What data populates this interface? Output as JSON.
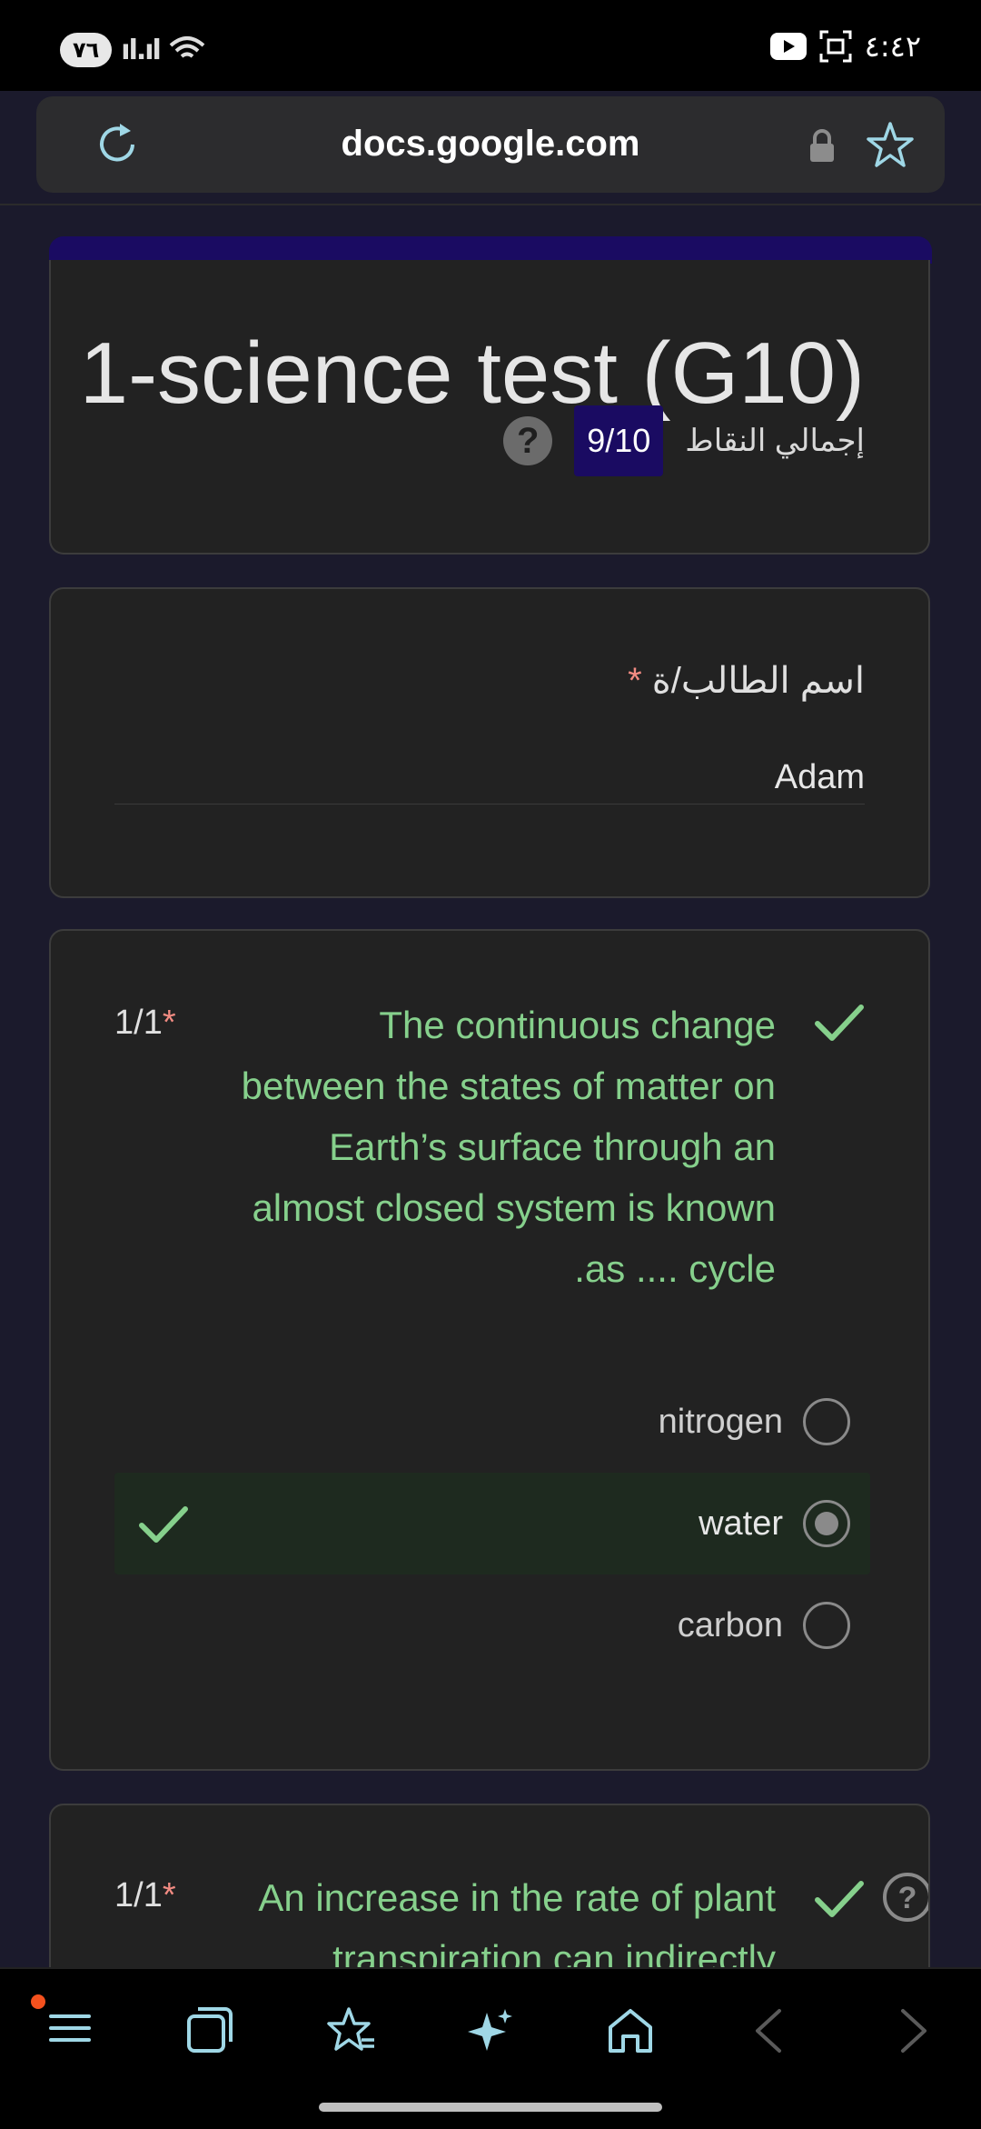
{
  "status_bar": {
    "battery": "٧٦",
    "signal": "ıl.ıl",
    "time": "٤:٤٢"
  },
  "browser": {
    "url": "docs.google.com"
  },
  "form": {
    "title": "1-science test (G10)",
    "score_label": "إجمالي النقاط",
    "score_value": "9/10",
    "name_question": {
      "label": "اسم الطالب/ة",
      "required_mark": "*",
      "answer": "Adam"
    },
    "questions": [
      {
        "points": "1/1",
        "required_mark": "*",
        "text_lines": [
          "The continuous change",
          "between the states of matter on",
          "Earth’s surface through an",
          "almost closed system is known",
          ".as .... cycle"
        ],
        "options": [
          "nitrogen",
          "water",
          "carbon"
        ],
        "selected": "water"
      },
      {
        "points": "1/1",
        "required_mark": "*",
        "text_lines": [
          "An increase in the rate of plant",
          "transpiration can indirectly"
        ]
      }
    ]
  },
  "colors": {
    "accent": "#1a0b62",
    "correct_green": "#86d08c",
    "required_red": "#f28b82"
  }
}
